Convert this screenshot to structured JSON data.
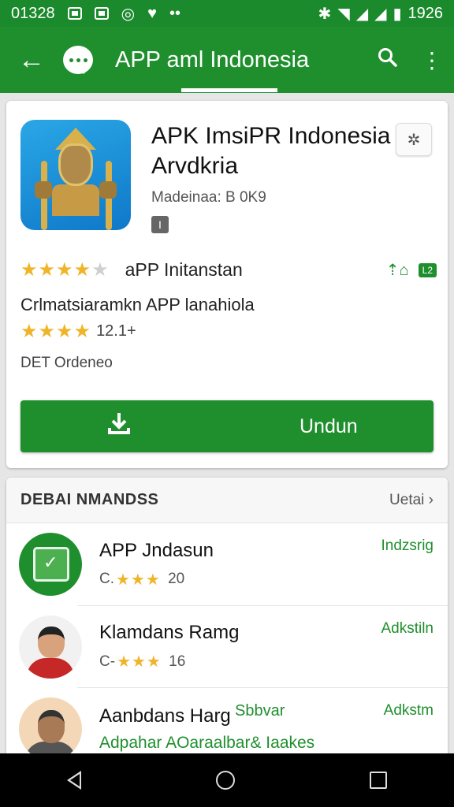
{
  "status_bar": {
    "time": "01328",
    "clock_right": "1926"
  },
  "app_bar": {
    "title": "APP aml Indonesia",
    "back_icon": "arrow-back-icon",
    "search_icon": "search-icon",
    "menu_icon": "overflow-menu-icon",
    "color": "#1f8f2e"
  },
  "app": {
    "title_line1": "APK ImsiPR Indonesia",
    "title_line2": "Arvdkria",
    "meta": "Madeinaa: B 0K9",
    "badge": "I",
    "rating_stars": 4,
    "rating_label": "aPP Initanstan",
    "tag": "L2",
    "subline": "Crlmatsiaramkn APP lanahiola",
    "sub_stars": 4,
    "sub_count": "12.1+",
    "det": "DET  Ordeneo",
    "download_label": "Undun"
  },
  "section": {
    "header": "DEBAI NMANDSS",
    "more": "Uetai",
    "items": [
      {
        "title": "APP Jndasun",
        "prefix": "C.",
        "stars": 3,
        "count": "20",
        "action": "Indzsrig"
      },
      {
        "title": "Klamdans Ramg",
        "prefix": "C-",
        "stars": 3,
        "count": "16",
        "action": "Adkstiln"
      },
      {
        "title": "Aanbdans Harg",
        "middle": "Sbbvar",
        "subtitle": "Adpahar AOaraalbar& Iaakes",
        "action": "Adkstm"
      }
    ]
  }
}
